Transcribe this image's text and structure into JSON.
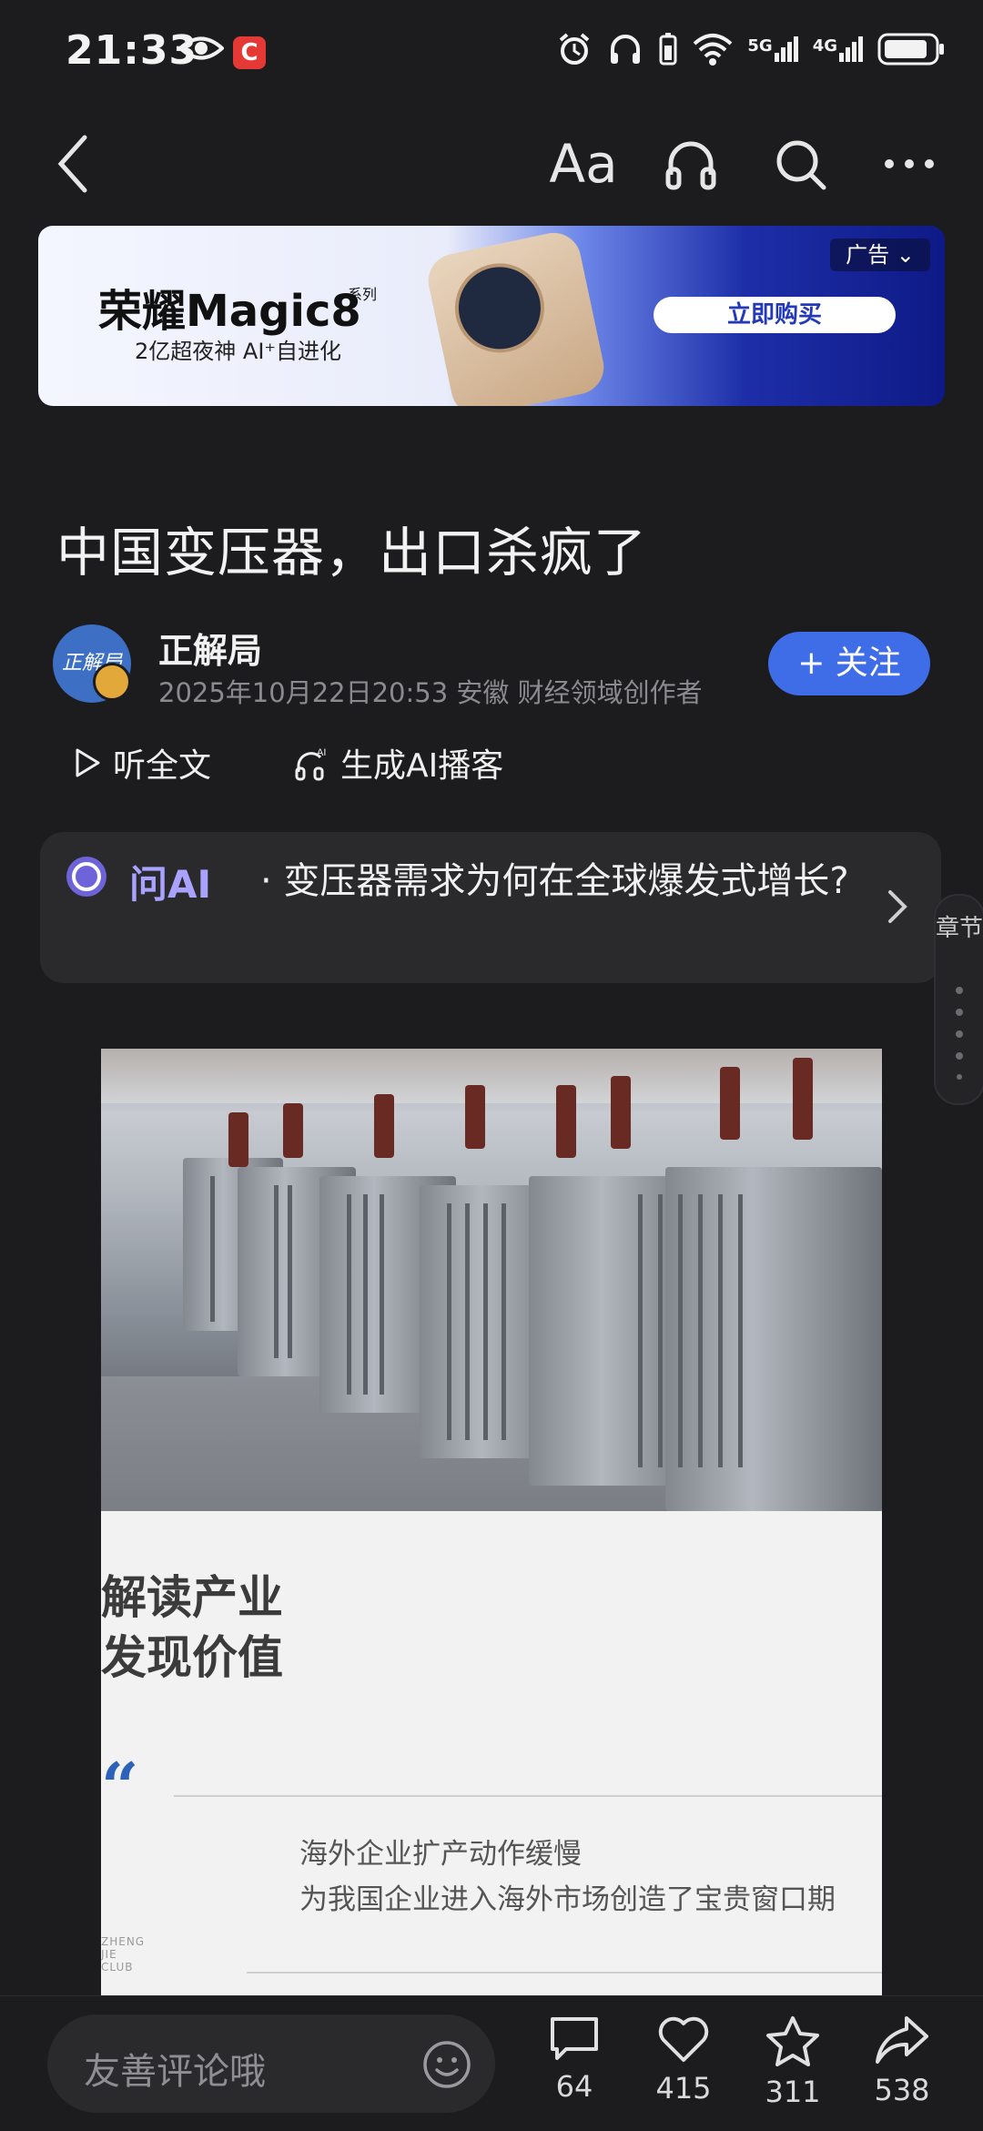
{
  "status_bar": {
    "time": "21:33",
    "network_5g": "5G",
    "network_4g": "4G",
    "app_badge": "C"
  },
  "nav": {
    "font_button": "Aa"
  },
  "ad": {
    "brand": "荣耀Magic8",
    "series": "系列",
    "slogan": "2亿超夜神 AI⁺自进化",
    "buy_button": "立即购买",
    "tag": "广告"
  },
  "article": {
    "title": "中国变压器，出口杀疯了",
    "author": "正解局",
    "avatar_text": "正解局",
    "meta": "2025年10月22日20:53 安徽 财经领域创作者",
    "follow_label": "+ 关注",
    "listen_label": "听全文",
    "podcast_label": "生成AI播客"
  },
  "ask_ai": {
    "label": "问AI",
    "question": "· 变压器需求为何在全球爆发式增长?"
  },
  "chapter": {
    "label": "章节"
  },
  "image": {
    "caption_line1": "解读产业",
    "caption_line2": "发现价值",
    "quote_mark": "“",
    "quote_line1": "海外企业扩产动作缓慢",
    "quote_line2": "为我国企业进入海外市场创造了宝贵窗口期",
    "club_line1": "ZHENG",
    "club_line2": "JIE",
    "club_line3": "CLUB"
  },
  "bottom_bar": {
    "comment_placeholder": "友善评论哦",
    "comments": "64",
    "likes": "415",
    "favorites": "311",
    "shares": "538"
  }
}
